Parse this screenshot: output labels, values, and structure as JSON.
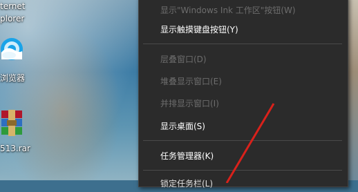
{
  "desktop": {
    "icons": [
      {
        "label_line1": "ternet",
        "label_line2": "plorer",
        "icon": "internet-explorer-icon"
      },
      {
        "label": "浏览器",
        "icon": "edge-browser-icon"
      },
      {
        "label": "513.rar",
        "icon": "winrar-archive-icon"
      }
    ]
  },
  "context_menu": {
    "items": [
      {
        "label": "显示\"Windows Ink 工作区\"按钮(W)",
        "enabled": false
      },
      {
        "label": "显示触摸键盘按钮(Y)",
        "enabled": true
      },
      {
        "label": "层叠窗口(D)",
        "enabled": false
      },
      {
        "label": "堆叠显示窗口(E)",
        "enabled": false
      },
      {
        "label": "并排显示窗口(I)",
        "enabled": false
      },
      {
        "label": "显示桌面(S)",
        "enabled": true
      },
      {
        "label": "任务管理器(K)",
        "enabled": true
      },
      {
        "label": "锁定任务栏(L)",
        "enabled": true
      }
    ]
  },
  "colors": {
    "menu_bg": "#2b2b2b",
    "enabled_text": "#ffffff",
    "disabled_text": "#6d6d6d",
    "arrow": "#d9211b"
  }
}
